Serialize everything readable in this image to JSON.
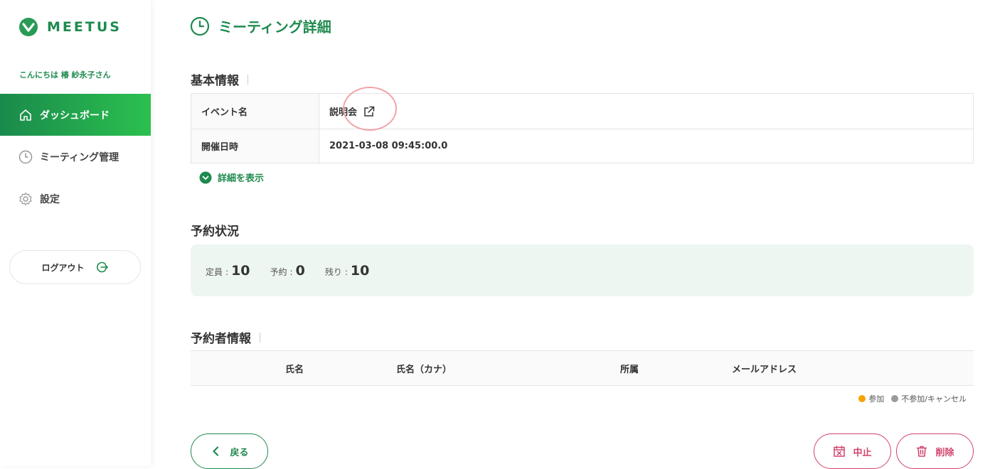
{
  "brand": {
    "name": "MEETUS",
    "color": "#1f8a4f",
    "accent_gradient": [
      "#1a8a4c",
      "#2bc04f"
    ],
    "danger": "#d2436b"
  },
  "sidebar": {
    "greeting": "こんにちは 椿 紗永子さん",
    "items": [
      {
        "label": "ダッシュボード",
        "icon": "home-icon",
        "active": true
      },
      {
        "label": "ミーティング管理",
        "icon": "clock-icon",
        "active": false
      },
      {
        "label": "設定",
        "icon": "gear-icon",
        "active": false
      }
    ],
    "logout_label": "ログアウト"
  },
  "page": {
    "title": "ミーティング詳細"
  },
  "basic_info": {
    "title": "基本情報",
    "rows": [
      {
        "key": "イベント名",
        "value": "説明会"
      },
      {
        "key": "開催日時",
        "value": "2021-03-08 09:45:00.0"
      }
    ],
    "toggle_label": "詳細を表示"
  },
  "reservation_status": {
    "title": "予約状況",
    "stats": [
      {
        "label": "定員",
        "value": "10"
      },
      {
        "label": "予約",
        "value": "0"
      },
      {
        "label": "残り",
        "value": "10"
      }
    ]
  },
  "bookers": {
    "title": "予約者情報",
    "columns": [
      "氏名",
      "氏名（カナ）",
      "所属",
      "メールアドレス"
    ],
    "legend": [
      {
        "label": "参加",
        "color": "#f5a300"
      },
      {
        "label": "不参加/キャンセル",
        "color": "#9a9a9a"
      }
    ]
  },
  "actions": {
    "back": "戻る",
    "cancel": "中止",
    "delete": "削除"
  }
}
